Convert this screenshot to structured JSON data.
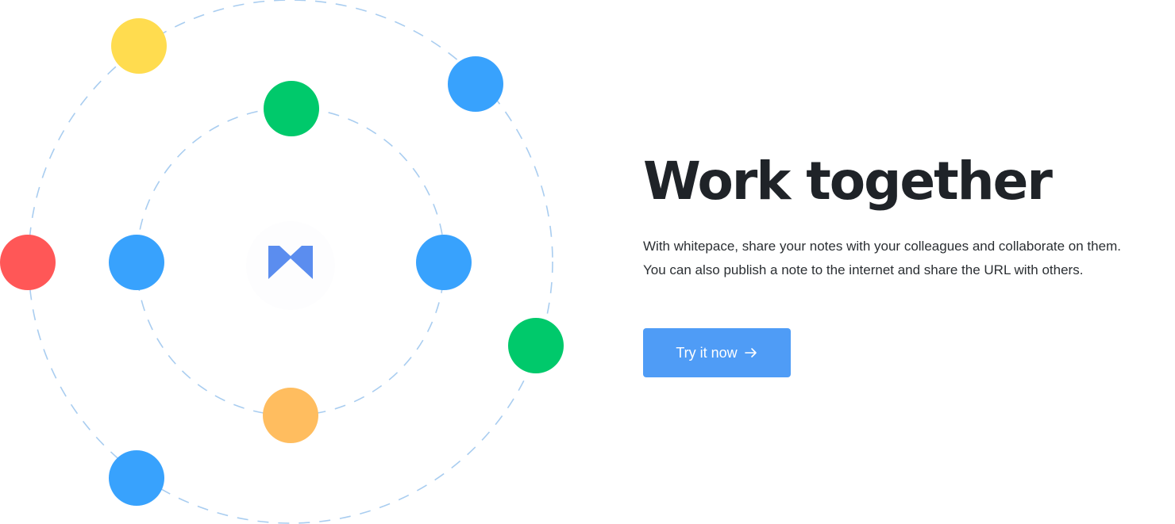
{
  "hero": {
    "title": "Work together",
    "description_lines": [
      "With whitepace, share your notes with your colleagues and collaborate on them.",
      "You can also publish a note to the internet and share the URL with others."
    ],
    "cta_label": "Try it now",
    "cta_icon": "arrow-right-icon"
  },
  "illustration": {
    "center_icon": "whitepace-logo-icon",
    "ring_color": "#a9cdf0",
    "logo_color": "#5b8def",
    "colors": {
      "yellow": "#ffdc4f",
      "blue": "#38a2fd",
      "green": "#00c96b",
      "red": "#ff5757",
      "orange": "#ffbd5f"
    }
  },
  "theme": {
    "button_color": "#4f9cf6",
    "heading_color": "#1f2328",
    "text_color": "#2b2f33"
  }
}
